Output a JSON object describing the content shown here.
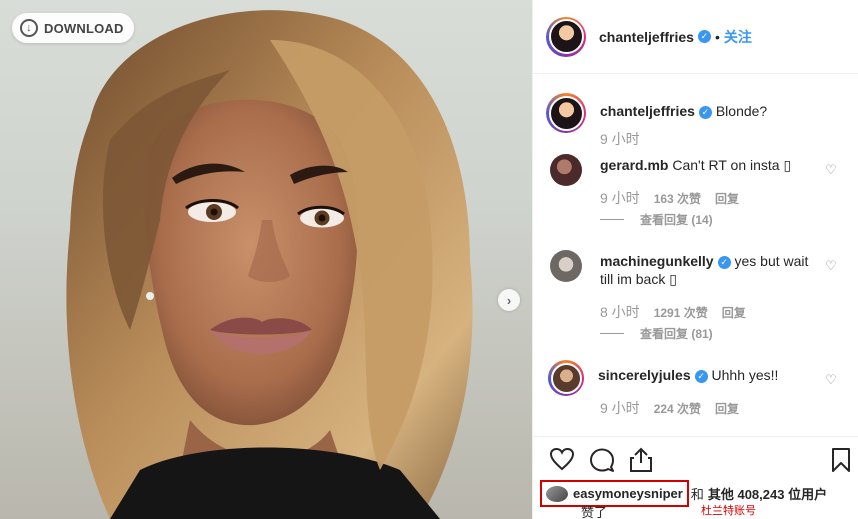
{
  "download": {
    "label": "DOWNLOAD"
  },
  "header": {
    "username": "chanteljeffries",
    "separator": "•",
    "follow_label": "关注"
  },
  "caption": {
    "username": "chanteljeffries",
    "text": "Blonde?",
    "time": "9 小时"
  },
  "comments": [
    {
      "username": "gerard.mb",
      "verified": false,
      "text": "Can't RT on insta ▯",
      "time": "9 小时",
      "likes": "163 次赞",
      "reply": "回复",
      "view_replies": "查看回复 (14)"
    },
    {
      "username": "machinegunkelly",
      "verified": true,
      "text": "yes but wait till im back ▯",
      "time": "8 小时",
      "likes": "1291 次赞",
      "reply": "回复",
      "view_replies": "查看回复 (81)"
    },
    {
      "username": "sincerelyjules",
      "verified": true,
      "text": "Uhhh yes!!",
      "time": "9 小时",
      "likes": "224 次赞",
      "reply": "回复"
    }
  ],
  "likes_line": {
    "liker": "easymoneysniper",
    "and": "和",
    "others": "其他 408,243 位用户",
    "tail": "赞了",
    "annotation": "杜兰特账号"
  },
  "colors": {
    "accent": "#3897f0",
    "highlight": "#d40000"
  },
  "icons": [
    "download-icon",
    "verified-icon",
    "heart-icon",
    "comment-icon",
    "share-icon",
    "bookmark-icon",
    "chevron-right-icon"
  ]
}
